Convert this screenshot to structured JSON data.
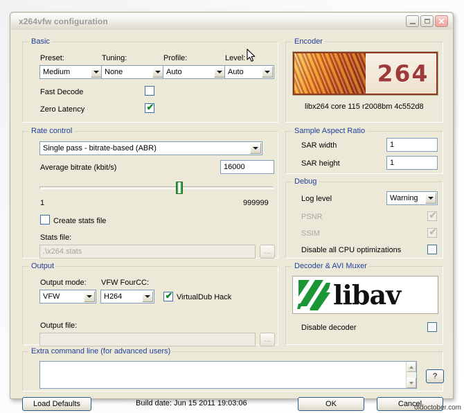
{
  "window": {
    "title": "x264vfw configuration",
    "minimize_label": "Minimize",
    "maximize_label": "Maximize",
    "close_label": "✕"
  },
  "basic": {
    "legend": "Basic",
    "preset_label": "Preset:",
    "preset_value": "Medium",
    "tuning_label": "Tuning:",
    "tuning_value": "None",
    "profile_label": "Profile:",
    "profile_value": "Auto",
    "level_label": "Level:",
    "level_value": "Auto",
    "fast_decode_label": "Fast Decode",
    "fast_decode_checked": false,
    "zero_latency_label": "Zero Latency",
    "zero_latency_checked": true,
    "check_glyph": "✔"
  },
  "rate_control": {
    "legend": "Rate control",
    "mode_value": "Single pass - bitrate-based (ABR)",
    "bitrate_label": "Average bitrate (kbit/s)",
    "bitrate_value": "16000",
    "slider_min": "1",
    "slider_max": "999999",
    "slider_percent": 60,
    "create_stats_label": "Create stats file",
    "create_stats_checked": false,
    "stats_file_label": "Stats file:",
    "stats_file_value": ".\\x264.stats",
    "browse_label": "..."
  },
  "output": {
    "legend": "Output",
    "output_mode_label": "Output mode:",
    "output_mode_value": "VFW",
    "fourcc_label": "VFW FourCC:",
    "fourcc_value": "H264",
    "vdub_hack_label": "VirtualDub Hack",
    "vdub_hack_checked": true,
    "output_file_label": "Output file:",
    "output_file_value": "",
    "browse_label": "..."
  },
  "encoder": {
    "legend": "Encoder",
    "logo_text": "264",
    "version": "libx264 core 115 r2008bm 4c552d8"
  },
  "sample_aspect_ratio": {
    "legend": "Sample Aspect Ratio",
    "sar_width_label": "SAR width",
    "sar_width_value": "1",
    "sar_height_label": "SAR height",
    "sar_height_value": "1"
  },
  "debug": {
    "legend": "Debug",
    "log_level_label": "Log level",
    "log_level_value": "Warning",
    "psnr_label": "PSNR",
    "psnr_checked": true,
    "psnr_disabled": true,
    "ssim_label": "SSIM",
    "ssim_checked": true,
    "ssim_disabled": true,
    "disable_cpu_label": "Disable all CPU optimizations",
    "disable_cpu_checked": false
  },
  "decoder": {
    "legend": "Decoder & AVI Muxer",
    "logo_text": "libav",
    "disable_decoder_label": "Disable decoder",
    "disable_decoder_checked": false
  },
  "extra": {
    "legend": "Extra command line (for advanced users)",
    "value": "",
    "help_label": "?"
  },
  "footer": {
    "load_defaults_label": "Load Defaults",
    "build_date": "Build date: Jun 15 2011 19:03:06",
    "ok_label": "OK",
    "cancel_label": "Cancel"
  },
  "watermark": "oldoctober.com",
  "colors": {
    "dialog_bg": "#ece9d8",
    "group_legend": "#21409a",
    "check_green": "#0a8a2a",
    "libav_green": "#1a9637",
    "x264_red": "#9e3b3a"
  }
}
